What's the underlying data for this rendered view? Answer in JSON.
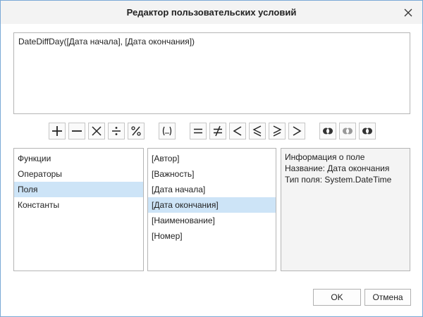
{
  "window": {
    "title": "Редактор пользовательских условий"
  },
  "editor": {
    "text": "DateDiffDay([Дата начала], [Дата окончания])"
  },
  "toolbar": {
    "buttons": [
      {
        "name": "plus-button",
        "icon": "plus-icon"
      },
      {
        "name": "minus-button",
        "icon": "minus-icon"
      },
      {
        "name": "multiply-button",
        "icon": "multiply-icon"
      },
      {
        "name": "divide-button",
        "icon": "divide-icon"
      },
      {
        "name": "percent-button",
        "icon": "percent-icon"
      },
      {
        "name": "brackets-button",
        "icon": "brackets-icon"
      },
      {
        "name": "equal-button",
        "icon": "equal-icon"
      },
      {
        "name": "not-equal-button",
        "icon": "not-equal-icon"
      },
      {
        "name": "less-button",
        "icon": "less-than-icon"
      },
      {
        "name": "less-or-equal-button",
        "icon": "less-or-equal-icon"
      },
      {
        "name": "greater-or-equal-button",
        "icon": "greater-or-equal-icon"
      },
      {
        "name": "greater-button",
        "icon": "greater-than-icon"
      },
      {
        "name": "and-button",
        "icon": "logical-and-icon"
      },
      {
        "name": "or-button",
        "icon": "logical-or-icon"
      },
      {
        "name": "not-button",
        "icon": "logical-not-icon"
      }
    ]
  },
  "categories": {
    "items": [
      "Функции",
      "Операторы",
      "Поля",
      "Константы"
    ],
    "selected": "Поля"
  },
  "fields": {
    "items": [
      "[Автор]",
      "[Важность]",
      "[Дата начала]",
      "[Дата окончания]",
      "[Наименование]",
      "[Номер]"
    ],
    "selected": "[Дата окончания]"
  },
  "info": {
    "heading": "Информация о поле",
    "name_line": "Название: Дата окончания",
    "type_line": "Тип поля: System.DateTime"
  },
  "footer": {
    "ok_label": "OK",
    "cancel_label": "Отмена"
  },
  "colors": {
    "selection": "#cde4f7",
    "window_border": "#7aa9d6"
  }
}
